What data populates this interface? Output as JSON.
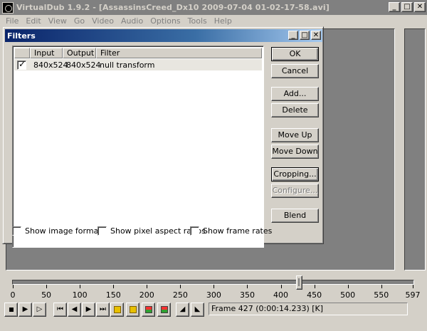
{
  "window": {
    "title": "VirtualDub 1.9.2 - [AssassinsCreed_Dx10 2009-07-04 01-02-17-58.avi]",
    "minimize_glyph": "_",
    "maximize_glyph": "□",
    "close_glyph": "✕"
  },
  "menu": [
    "File",
    "Edit",
    "View",
    "Go",
    "Video",
    "Audio",
    "Options",
    "Tools",
    "Help"
  ],
  "dialog": {
    "title": "Filters",
    "columns": [
      "Input",
      "Output",
      "Filter"
    ],
    "rows": [
      {
        "checked": true,
        "input": "840x524",
        "output": "840x524",
        "filter": "null transform"
      }
    ],
    "buttons": {
      "ok": "OK",
      "cancel": "Cancel",
      "add": "Add...",
      "delete": "Delete",
      "move_up": "Move Up",
      "move_down": "Move Down",
      "cropping": "Cropping...",
      "configure": "Configure...",
      "blend": "Blend"
    },
    "options": {
      "image_formats": "Show image formats",
      "pixel_aspect": "Show pixel aspect ratios",
      "frame_rates": "Show frame rates"
    }
  },
  "timeline": {
    "min": 0,
    "max": 597,
    "current_frame": 427,
    "tick_labels": [
      "0",
      "50",
      "100",
      "150",
      "200",
      "250",
      "300",
      "350",
      "400",
      "450",
      "500",
      "550",
      "597"
    ]
  },
  "status": {
    "frame_text": "Frame 427 (0:00:14.233) [K]"
  },
  "toolbar_icons": [
    "stop-icon",
    "play-input-icon",
    "play-output-icon",
    "go-start-icon",
    "prev-frame-icon",
    "next-frame-icon",
    "go-end-icon",
    "prev-key-icon",
    "next-key-icon",
    "scene-back-icon",
    "scene-forward-icon",
    "mark-in-icon",
    "mark-out-icon"
  ]
}
